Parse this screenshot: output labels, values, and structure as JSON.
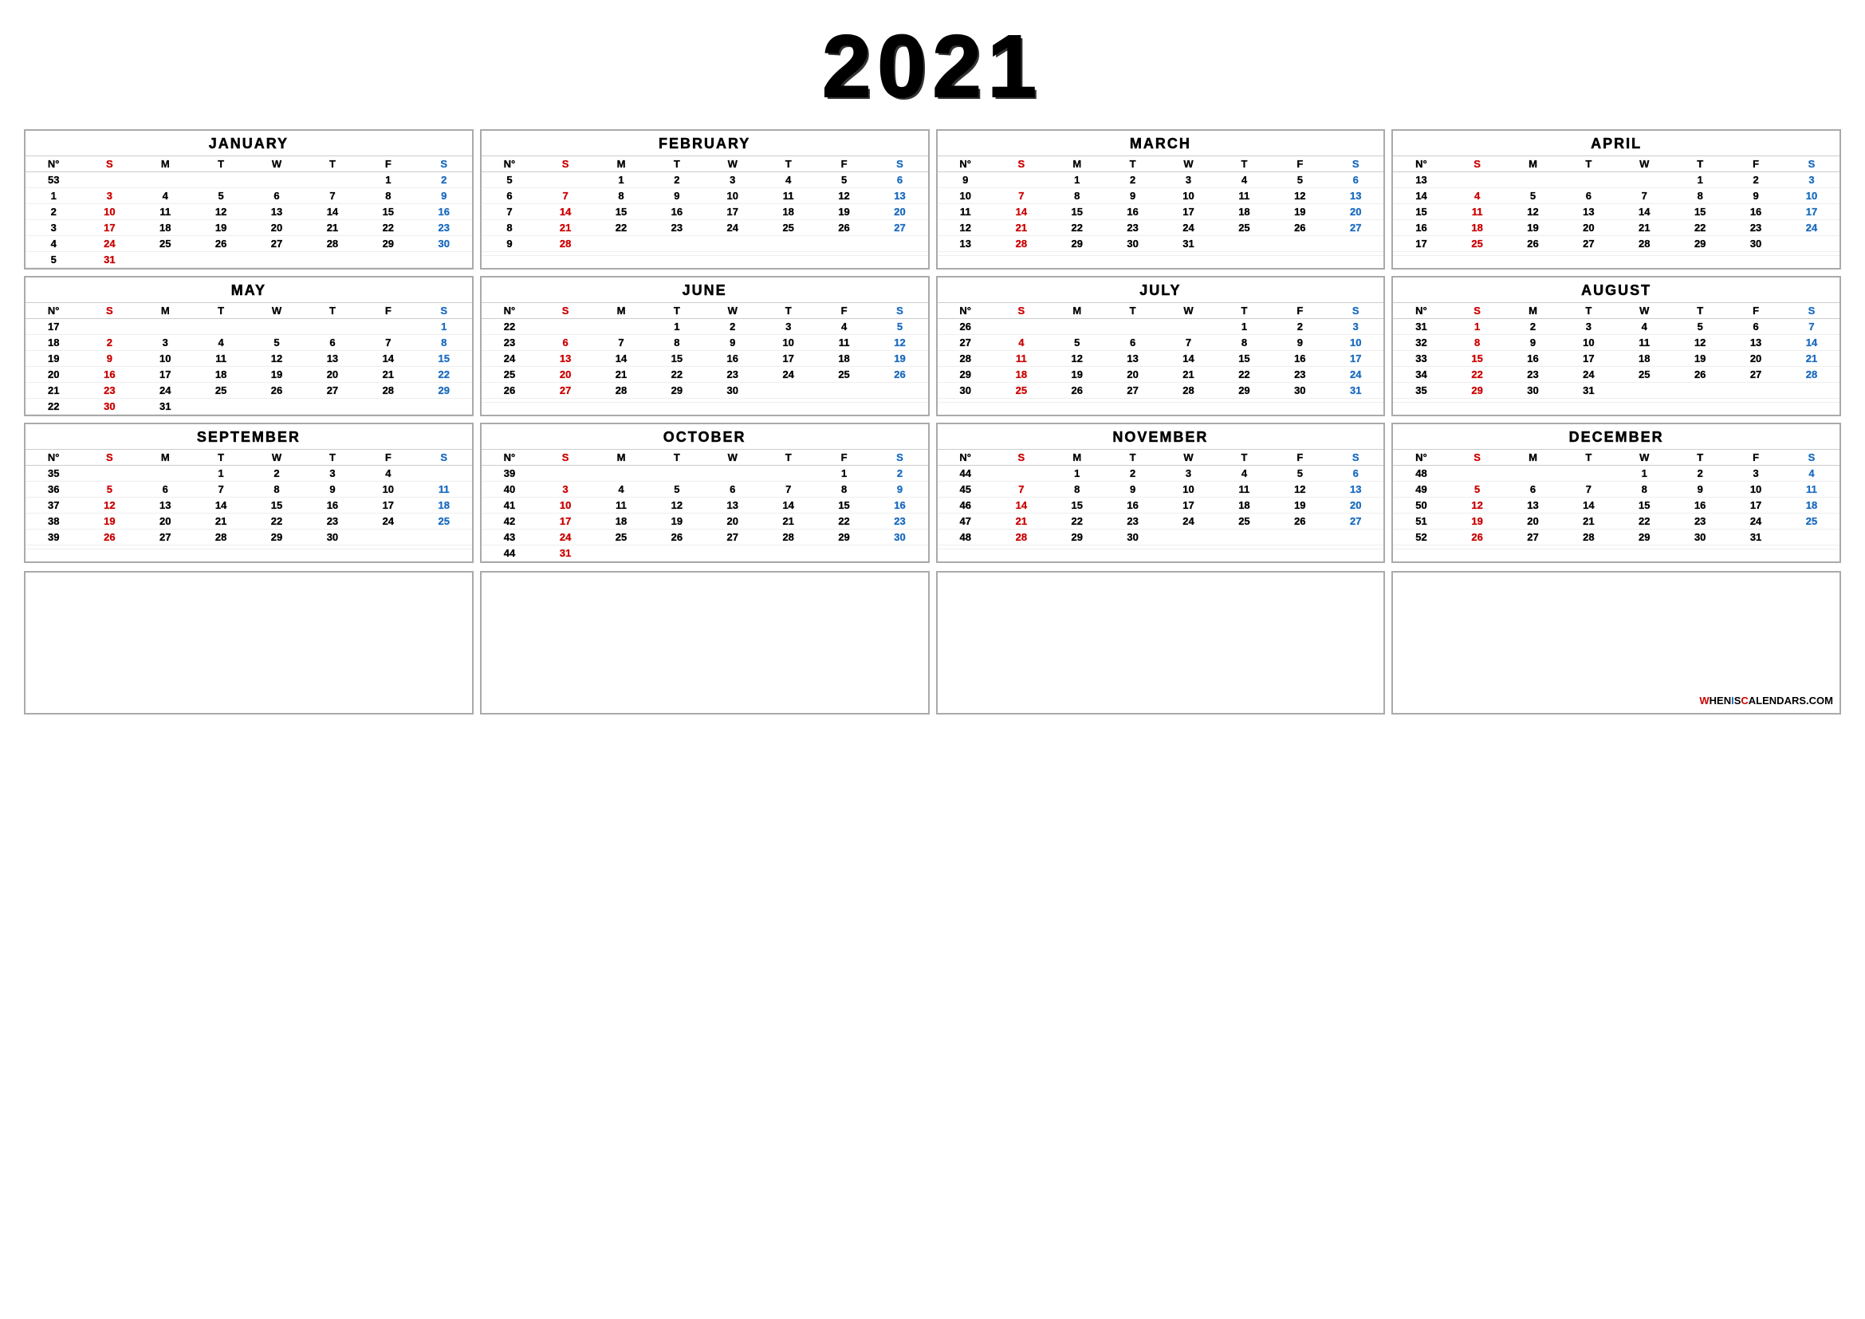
{
  "year": "2021",
  "months": [
    {
      "name": "JANUARY",
      "weeks": [
        {
          "wn": "53",
          "sun": "",
          "mon": "",
          "tue": "",
          "wed": "",
          "thu": "",
          "fri": "1",
          "sat": "2"
        },
        {
          "wn": "1",
          "sun": "3",
          "mon": "4",
          "tue": "5",
          "wed": "6",
          "thu": "7",
          "fri": "8",
          "sat": "9"
        },
        {
          "wn": "2",
          "sun": "10",
          "mon": "11",
          "tue": "12",
          "wed": "13",
          "thu": "14",
          "fri": "15",
          "sat": "16"
        },
        {
          "wn": "3",
          "sun": "17",
          "mon": "18",
          "tue": "19",
          "wed": "20",
          "thu": "21",
          "fri": "22",
          "sat": "23"
        },
        {
          "wn": "4",
          "sun": "24",
          "mon": "25",
          "tue": "26",
          "wed": "27",
          "thu": "28",
          "fri": "29",
          "sat": "30"
        },
        {
          "wn": "5",
          "sun": "31",
          "mon": "",
          "tue": "",
          "wed": "",
          "thu": "",
          "fri": "",
          "sat": ""
        }
      ]
    },
    {
      "name": "FEBRUARY",
      "weeks": [
        {
          "wn": "5",
          "sun": "",
          "mon": "1",
          "tue": "2",
          "wed": "3",
          "thu": "4",
          "fri": "5",
          "sat": "6"
        },
        {
          "wn": "6",
          "sun": "7",
          "mon": "8",
          "tue": "9",
          "wed": "10",
          "thu": "11",
          "fri": "12",
          "sat": "13"
        },
        {
          "wn": "7",
          "sun": "14",
          "mon": "15",
          "tue": "16",
          "wed": "17",
          "thu": "18",
          "fri": "19",
          "sat": "20"
        },
        {
          "wn": "8",
          "sun": "21",
          "mon": "22",
          "tue": "23",
          "wed": "24",
          "thu": "25",
          "fri": "26",
          "sat": "27"
        },
        {
          "wn": "9",
          "sun": "28",
          "mon": "",
          "tue": "",
          "wed": "",
          "thu": "",
          "fri": "",
          "sat": ""
        },
        {
          "wn": "",
          "sun": "",
          "mon": "",
          "tue": "",
          "wed": "",
          "thu": "",
          "fri": "",
          "sat": ""
        }
      ]
    },
    {
      "name": "MARCH",
      "weeks": [
        {
          "wn": "9",
          "sun": "",
          "mon": "1",
          "tue": "2",
          "wed": "3",
          "thu": "4",
          "fri": "5",
          "sat": "6"
        },
        {
          "wn": "10",
          "sun": "7",
          "mon": "8",
          "tue": "9",
          "wed": "10",
          "thu": "11",
          "fri": "12",
          "sat": "13"
        },
        {
          "wn": "11",
          "sun": "14",
          "mon": "15",
          "tue": "16",
          "wed": "17",
          "thu": "18",
          "fri": "19",
          "sat": "20"
        },
        {
          "wn": "12",
          "sun": "21",
          "mon": "22",
          "tue": "23",
          "wed": "24",
          "thu": "25",
          "fri": "26",
          "sat": "27"
        },
        {
          "wn": "13",
          "sun": "28",
          "mon": "29",
          "tue": "30",
          "wed": "31",
          "thu": "",
          "fri": "",
          "sat": ""
        },
        {
          "wn": "",
          "sun": "",
          "mon": "",
          "tue": "",
          "wed": "",
          "thu": "",
          "fri": "",
          "sat": ""
        }
      ]
    },
    {
      "name": "APRIL",
      "weeks": [
        {
          "wn": "13",
          "sun": "",
          "mon": "",
          "tue": "",
          "wed": "",
          "thu": "1",
          "fri": "2",
          "sat": "3"
        },
        {
          "wn": "14",
          "sun": "4",
          "mon": "5",
          "tue": "6",
          "wed": "7",
          "thu": "8",
          "fri": "9",
          "sat": "10"
        },
        {
          "wn": "15",
          "sun": "11",
          "mon": "12",
          "tue": "13",
          "wed": "14",
          "thu": "15",
          "fri": "16",
          "sat": "17"
        },
        {
          "wn": "16",
          "sun": "18",
          "mon": "19",
          "tue": "20",
          "wed": "21",
          "thu": "22",
          "fri": "23",
          "sat": "24"
        },
        {
          "wn": "17",
          "sun": "25",
          "mon": "26",
          "tue": "27",
          "wed": "28",
          "thu": "29",
          "fri": "30",
          "sat": ""
        },
        {
          "wn": "",
          "sun": "",
          "mon": "",
          "tue": "",
          "wed": "",
          "thu": "",
          "fri": "",
          "sat": ""
        }
      ]
    },
    {
      "name": "MAY",
      "weeks": [
        {
          "wn": "17",
          "sun": "",
          "mon": "",
          "tue": "",
          "wed": "",
          "thu": "",
          "fri": "",
          "sat": "1"
        },
        {
          "wn": "18",
          "sun": "2",
          "mon": "3",
          "tue": "4",
          "wed": "5",
          "thu": "6",
          "fri": "7",
          "sat": "8"
        },
        {
          "wn": "19",
          "sun": "9",
          "mon": "10",
          "tue": "11",
          "wed": "12",
          "thu": "13",
          "fri": "14",
          "sat": "15"
        },
        {
          "wn": "20",
          "sun": "16",
          "mon": "17",
          "tue": "18",
          "wed": "19",
          "thu": "20",
          "fri": "21",
          "sat": "22"
        },
        {
          "wn": "21",
          "sun": "23",
          "mon": "24",
          "tue": "25",
          "wed": "26",
          "thu": "27",
          "fri": "28",
          "sat": "29"
        },
        {
          "wn": "22",
          "sun": "30",
          "mon": "31",
          "tue": "",
          "wed": "",
          "thu": "",
          "fri": "",
          "sat": ""
        }
      ]
    },
    {
      "name": "JUNE",
      "weeks": [
        {
          "wn": "22",
          "sun": "",
          "mon": "",
          "tue": "1",
          "wed": "2",
          "thu": "3",
          "fri": "4",
          "sat": "5"
        },
        {
          "wn": "23",
          "sun": "6",
          "mon": "7",
          "tue": "8",
          "wed": "9",
          "thu": "10",
          "fri": "11",
          "sat": "12"
        },
        {
          "wn": "24",
          "sun": "13",
          "mon": "14",
          "tue": "15",
          "wed": "16",
          "thu": "17",
          "fri": "18",
          "sat": "19"
        },
        {
          "wn": "25",
          "sun": "20",
          "mon": "21",
          "tue": "22",
          "wed": "23",
          "thu": "24",
          "fri": "25",
          "sat": "26"
        },
        {
          "wn": "26",
          "sun": "27",
          "mon": "28",
          "tue": "29",
          "wed": "30",
          "thu": "",
          "fri": "",
          "sat": ""
        },
        {
          "wn": "",
          "sun": "",
          "mon": "",
          "tue": "",
          "wed": "",
          "thu": "",
          "fri": "",
          "sat": ""
        }
      ]
    },
    {
      "name": "JULY",
      "weeks": [
        {
          "wn": "26",
          "sun": "",
          "mon": "",
          "tue": "",
          "wed": "",
          "thu": "1",
          "fri": "2",
          "sat": "3"
        },
        {
          "wn": "27",
          "sun": "4",
          "mon": "5",
          "tue": "6",
          "wed": "7",
          "thu": "8",
          "fri": "9",
          "sat": "10"
        },
        {
          "wn": "28",
          "sun": "11",
          "mon": "12",
          "tue": "13",
          "wed": "14",
          "thu": "15",
          "fri": "16",
          "sat": "17"
        },
        {
          "wn": "29",
          "sun": "18",
          "mon": "19",
          "tue": "20",
          "wed": "21",
          "thu": "22",
          "fri": "23",
          "sat": "24"
        },
        {
          "wn": "30",
          "sun": "25",
          "mon": "26",
          "tue": "27",
          "wed": "28",
          "thu": "29",
          "fri": "30",
          "sat": "31"
        },
        {
          "wn": "",
          "sun": "",
          "mon": "",
          "tue": "",
          "wed": "",
          "thu": "",
          "fri": "",
          "sat": ""
        }
      ]
    },
    {
      "name": "AUGUST",
      "weeks": [
        {
          "wn": "31",
          "sun": "1",
          "mon": "2",
          "tue": "3",
          "wed": "4",
          "thu": "5",
          "fri": "6",
          "sat": "7"
        },
        {
          "wn": "32",
          "sun": "8",
          "mon": "9",
          "tue": "10",
          "wed": "11",
          "thu": "12",
          "fri": "13",
          "sat": "14"
        },
        {
          "wn": "33",
          "sun": "15",
          "mon": "16",
          "tue": "17",
          "wed": "18",
          "thu": "19",
          "fri": "20",
          "sat": "21"
        },
        {
          "wn": "34",
          "sun": "22",
          "mon": "23",
          "tue": "24",
          "wed": "25",
          "thu": "26",
          "fri": "27",
          "sat": "28"
        },
        {
          "wn": "35",
          "sun": "29",
          "mon": "30",
          "tue": "31",
          "wed": "",
          "thu": "",
          "fri": "",
          "sat": ""
        },
        {
          "wn": "",
          "sun": "",
          "mon": "",
          "tue": "",
          "wed": "",
          "thu": "",
          "fri": "",
          "sat": ""
        }
      ]
    },
    {
      "name": "SEPTEMBER",
      "weeks": [
        {
          "wn": "35",
          "sun": "",
          "mon": "",
          "tue": "1",
          "wed": "2",
          "thu": "3",
          "fri": "4",
          "sat": ""
        },
        {
          "wn": "36",
          "sun": "5",
          "mon": "6",
          "tue": "7",
          "wed": "8",
          "thu": "9",
          "fri": "10",
          "sat": "11"
        },
        {
          "wn": "37",
          "sun": "12",
          "mon": "13",
          "tue": "14",
          "wed": "15",
          "thu": "16",
          "fri": "17",
          "sat": "18"
        },
        {
          "wn": "38",
          "sun": "19",
          "mon": "20",
          "tue": "21",
          "wed": "22",
          "thu": "23",
          "fri": "24",
          "sat": "25"
        },
        {
          "wn": "39",
          "sun": "26",
          "mon": "27",
          "tue": "28",
          "wed": "29",
          "thu": "30",
          "fri": "",
          "sat": ""
        },
        {
          "wn": "",
          "sun": "",
          "mon": "",
          "tue": "",
          "wed": "",
          "thu": "",
          "fri": "",
          "sat": ""
        }
      ]
    },
    {
      "name": "OCTOBER",
      "weeks": [
        {
          "wn": "39",
          "sun": "",
          "mon": "",
          "tue": "",
          "wed": "",
          "thu": "",
          "fri": "1",
          "sat": "2"
        },
        {
          "wn": "40",
          "sun": "3",
          "mon": "4",
          "tue": "5",
          "wed": "6",
          "thu": "7",
          "fri": "8",
          "sat": "9"
        },
        {
          "wn": "41",
          "sun": "10",
          "mon": "11",
          "tue": "12",
          "wed": "13",
          "thu": "14",
          "fri": "15",
          "sat": "16"
        },
        {
          "wn": "42",
          "sun": "17",
          "mon": "18",
          "tue": "19",
          "wed": "20",
          "thu": "21",
          "fri": "22",
          "sat": "23"
        },
        {
          "wn": "43",
          "sun": "24",
          "mon": "25",
          "tue": "26",
          "wed": "27",
          "thu": "28",
          "fri": "29",
          "sat": "30"
        },
        {
          "wn": "44",
          "sun": "31",
          "mon": "",
          "tue": "",
          "wed": "",
          "thu": "",
          "fri": "",
          "sat": ""
        }
      ]
    },
    {
      "name": "NOVEMBER",
      "weeks": [
        {
          "wn": "44",
          "sun": "",
          "mon": "1",
          "tue": "2",
          "wed": "3",
          "thu": "4",
          "fri": "5",
          "sat": "6"
        },
        {
          "wn": "45",
          "sun": "7",
          "mon": "8",
          "tue": "9",
          "wed": "10",
          "thu": "11",
          "fri": "12",
          "sat": "13"
        },
        {
          "wn": "46",
          "sun": "14",
          "mon": "15",
          "tue": "16",
          "wed": "17",
          "thu": "18",
          "fri": "19",
          "sat": "20"
        },
        {
          "wn": "47",
          "sun": "21",
          "mon": "22",
          "tue": "23",
          "wed": "24",
          "thu": "25",
          "fri": "26",
          "sat": "27"
        },
        {
          "wn": "48",
          "sun": "28",
          "mon": "29",
          "tue": "30",
          "wed": "",
          "thu": "",
          "fri": "",
          "sat": ""
        },
        {
          "wn": "",
          "sun": "",
          "mon": "",
          "tue": "",
          "wed": "",
          "thu": "",
          "fri": "",
          "sat": ""
        }
      ]
    },
    {
      "name": "DECEMBER",
      "weeks": [
        {
          "wn": "48",
          "sun": "",
          "mon": "",
          "tue": "",
          "wed": "1",
          "thu": "2",
          "fri": "3",
          "sat": "4"
        },
        {
          "wn": "49",
          "sun": "5",
          "mon": "6",
          "tue": "7",
          "wed": "8",
          "thu": "9",
          "fri": "10",
          "sat": "11"
        },
        {
          "wn": "50",
          "sun": "12",
          "mon": "13",
          "tue": "14",
          "wed": "15",
          "thu": "16",
          "fri": "17",
          "sat": "18"
        },
        {
          "wn": "51",
          "sun": "19",
          "mon": "20",
          "tue": "21",
          "wed": "22",
          "thu": "23",
          "fri": "24",
          "sat": "25"
        },
        {
          "wn": "52",
          "sun": "26",
          "mon": "27",
          "tue": "28",
          "wed": "29",
          "thu": "30",
          "fri": "31",
          "sat": ""
        },
        {
          "wn": "",
          "sun": "",
          "mon": "",
          "tue": "",
          "wed": "",
          "thu": "",
          "fri": "",
          "sat": ""
        }
      ]
    }
  ],
  "headers": {
    "week": "N°",
    "sun": "S",
    "mon": "M",
    "tue": "T",
    "wed": "W",
    "thu": "T",
    "fri": "F",
    "sat": "S"
  },
  "watermark": "WHENISCALENDARS.COM"
}
